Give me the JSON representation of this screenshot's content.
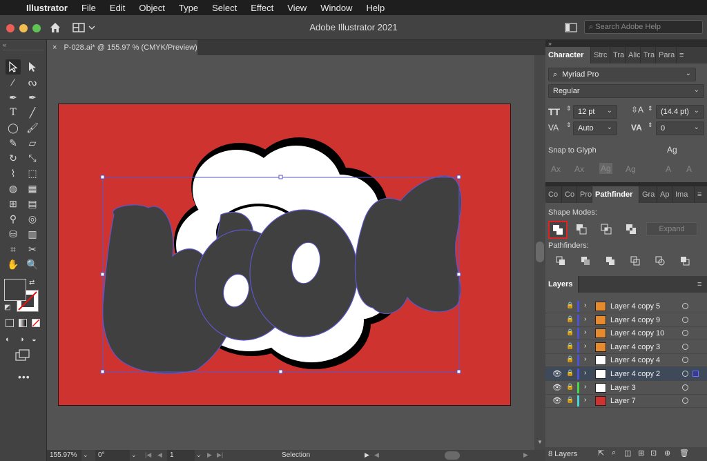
{
  "menubar": {
    "app": "Illustrator",
    "items": [
      "File",
      "Edit",
      "Object",
      "Type",
      "Select",
      "Effect",
      "View",
      "Window",
      "Help"
    ]
  },
  "appbar": {
    "title": "Adobe Illustrator 2021",
    "search_placeholder": "Search Adobe Help"
  },
  "document": {
    "tab_label": "P-028.ai* @ 155.97 % (CMYK/Preview)",
    "close_glyph": "×"
  },
  "canvas": {
    "artboard_color": "#cf3330",
    "artwork_text": "WOOM",
    "cloud_color": "#ffffff",
    "letters_color": "#404040",
    "selection_color": "#5b57c8"
  },
  "status": {
    "zoom": "155.97%",
    "rotation": "0°",
    "artboard_number": "1",
    "tool": "Selection"
  },
  "character_panel": {
    "tabs": [
      "Character",
      "Strc",
      "Tra",
      "Alic",
      "Tra",
      "Para"
    ],
    "font_family": "Myriad Pro",
    "font_style": "Regular",
    "font_size": "12 pt",
    "leading": "(14.4 pt)",
    "kerning": "Auto",
    "tracking": "0",
    "snap_to_glyph": "Snap to Glyph"
  },
  "pathfinder_panel": {
    "tabs": [
      "Co",
      "Co",
      "Pro",
      "Pathfinder",
      "Gra",
      "Ap",
      "Ima"
    ],
    "shape_modes_label": "Shape Modes:",
    "expand_label": "Expand",
    "pathfinders_label": "Pathfinders:"
  },
  "layers_panel": {
    "title": "Layers",
    "count_label": "8 Layers",
    "rows": [
      {
        "name": "Layer 4 copy 5",
        "color": "#4a52d6",
        "visible": false,
        "selected": false
      },
      {
        "name": "Layer 4 copy 9",
        "color": "#4a52d6",
        "visible": false,
        "selected": false
      },
      {
        "name": "Layer 4 copy 10",
        "color": "#4a52d6",
        "visible": false,
        "selected": false
      },
      {
        "name": "Layer 4 copy 3",
        "color": "#4a52d6",
        "visible": false,
        "selected": false
      },
      {
        "name": "Layer 4 copy 4",
        "color": "#4a52d6",
        "visible": false,
        "selected": false
      },
      {
        "name": "Layer 4 copy 2",
        "color": "#4a52d6",
        "visible": true,
        "selected": true
      },
      {
        "name": "Layer 3",
        "color": "#4ad64a",
        "visible": true,
        "selected": false
      },
      {
        "name": "Layer 7",
        "color": "#4ad6d6",
        "visible": true,
        "selected": false
      }
    ]
  }
}
